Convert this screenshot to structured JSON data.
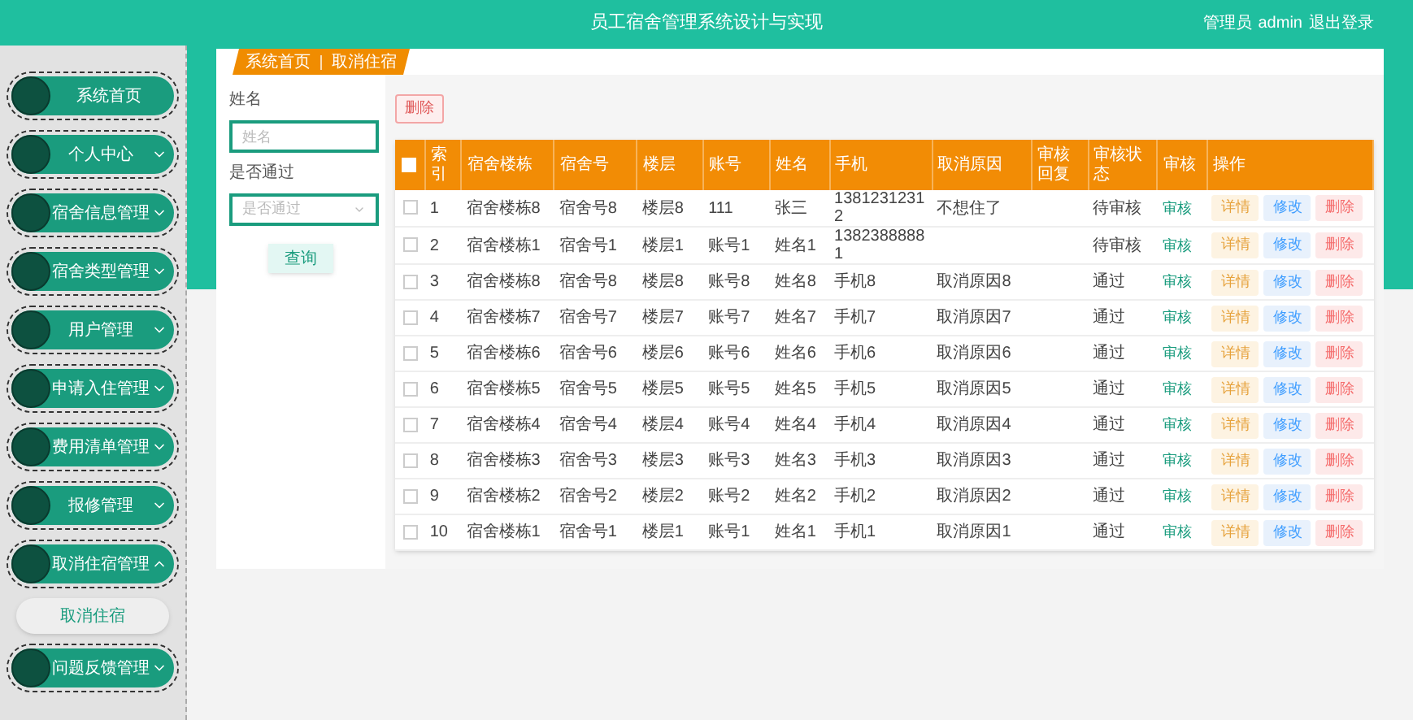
{
  "header": {
    "title": "员工宿舍管理系统设计与实现",
    "user_role": "管理员",
    "username": "admin",
    "logout": "退出登录"
  },
  "sidebar": {
    "items": [
      {
        "label": "系统首页"
      },
      {
        "label": "个人中心",
        "expanded": false
      },
      {
        "label": "宿舍信息管理",
        "expanded": false
      },
      {
        "label": "宿舍类型管理",
        "expanded": false
      },
      {
        "label": "用户管理",
        "expanded": false
      },
      {
        "label": "申请入住管理",
        "expanded": false
      },
      {
        "label": "费用清单管理",
        "expanded": false
      },
      {
        "label": "报修管理",
        "expanded": false
      },
      {
        "label": "取消住宿管理",
        "expanded": true,
        "children": [
          {
            "label": "取消住宿",
            "selected": true
          }
        ]
      },
      {
        "label": "问题反馈管理",
        "expanded": false
      }
    ]
  },
  "breadcrumb": [
    "系统首页",
    "取消住宿"
  ],
  "search": {
    "fields": [
      {
        "label": "姓名",
        "kind": "input",
        "placeholder": "姓名"
      },
      {
        "label": "是否通过",
        "kind": "select",
        "placeholder": "是否通过"
      }
    ],
    "button": "查询"
  },
  "table": {
    "delete_button": "删除",
    "select_all": {
      "checked": false
    },
    "columns": [
      "索引",
      "宿舍楼栋",
      "宿舍号",
      "楼层",
      "账号",
      "姓名",
      "手机",
      "取消原因",
      "审核回复",
      "审核状态",
      "审核",
      "操作"
    ],
    "rows": [
      {
        "checked": false,
        "cells": [
          "1",
          "宿舍楼栋8",
          "宿舍号8",
          "楼层8",
          "111",
          "张三",
          "13812312312",
          "不想住了",
          "",
          "待审核"
        ],
        "review": "审核",
        "actions": [
          {
            "label": "详情",
            "kind": "detail"
          },
          {
            "label": "修改",
            "kind": "edit"
          },
          {
            "label": "删除",
            "kind": "delete"
          }
        ]
      },
      {
        "checked": false,
        "cells": [
          "2",
          "宿舍楼栋1",
          "宿舍号1",
          "楼层1",
          "账号1",
          "姓名1",
          "13823888881",
          "",
          "",
          "待审核"
        ],
        "review": "审核",
        "actions": [
          {
            "label": "详情",
            "kind": "detail"
          },
          {
            "label": "修改",
            "kind": "edit"
          },
          {
            "label": "删除",
            "kind": "delete"
          }
        ]
      },
      {
        "checked": false,
        "cells": [
          "3",
          "宿舍楼栋8",
          "宿舍号8",
          "楼层8",
          "账号8",
          "姓名8",
          "手机8",
          "取消原因8",
          "",
          "通过"
        ],
        "review": "审核",
        "actions": [
          {
            "label": "详情",
            "kind": "detail"
          },
          {
            "label": "修改",
            "kind": "edit"
          },
          {
            "label": "删除",
            "kind": "delete"
          }
        ]
      },
      {
        "checked": false,
        "cells": [
          "4",
          "宿舍楼栋7",
          "宿舍号7",
          "楼层7",
          "账号7",
          "姓名7",
          "手机7",
          "取消原因7",
          "",
          "通过"
        ],
        "review": "审核",
        "actions": [
          {
            "label": "详情",
            "kind": "detail"
          },
          {
            "label": "修改",
            "kind": "edit"
          },
          {
            "label": "删除",
            "kind": "delete"
          }
        ]
      },
      {
        "checked": false,
        "cells": [
          "5",
          "宿舍楼栋6",
          "宿舍号6",
          "楼层6",
          "账号6",
          "姓名6",
          "手机6",
          "取消原因6",
          "",
          "通过"
        ],
        "review": "审核",
        "actions": [
          {
            "label": "详情",
            "kind": "detail"
          },
          {
            "label": "修改",
            "kind": "edit"
          },
          {
            "label": "删除",
            "kind": "delete"
          }
        ]
      },
      {
        "checked": false,
        "cells": [
          "6",
          "宿舍楼栋5",
          "宿舍号5",
          "楼层5",
          "账号5",
          "姓名5",
          "手机5",
          "取消原因5",
          "",
          "通过"
        ],
        "review": "审核",
        "actions": [
          {
            "label": "详情",
            "kind": "detail"
          },
          {
            "label": "修改",
            "kind": "edit"
          },
          {
            "label": "删除",
            "kind": "delete"
          }
        ]
      },
      {
        "checked": false,
        "cells": [
          "7",
          "宿舍楼栋4",
          "宿舍号4",
          "楼层4",
          "账号4",
          "姓名4",
          "手机4",
          "取消原因4",
          "",
          "通过"
        ],
        "review": "审核",
        "actions": [
          {
            "label": "详情",
            "kind": "detail"
          },
          {
            "label": "修改",
            "kind": "edit"
          },
          {
            "label": "删除",
            "kind": "delete"
          }
        ]
      },
      {
        "checked": false,
        "cells": [
          "8",
          "宿舍楼栋3",
          "宿舍号3",
          "楼层3",
          "账号3",
          "姓名3",
          "手机3",
          "取消原因3",
          "",
          "通过"
        ],
        "review": "审核",
        "actions": [
          {
            "label": "详情",
            "kind": "detail"
          },
          {
            "label": "修改",
            "kind": "edit"
          },
          {
            "label": "删除",
            "kind": "delete"
          }
        ]
      },
      {
        "checked": false,
        "cells": [
          "9",
          "宿舍楼栋2",
          "宿舍号2",
          "楼层2",
          "账号2",
          "姓名2",
          "手机2",
          "取消原因2",
          "",
          "通过"
        ],
        "review": "审核",
        "actions": [
          {
            "label": "详情",
            "kind": "detail"
          },
          {
            "label": "修改",
            "kind": "edit"
          },
          {
            "label": "删除",
            "kind": "delete"
          }
        ]
      },
      {
        "checked": false,
        "cells": [
          "10",
          "宿舍楼栋1",
          "宿舍号1",
          "楼层1",
          "账号1",
          "姓名1",
          "手机1",
          "取消原因1",
          "",
          "通过"
        ],
        "review": "审核",
        "actions": [
          {
            "label": "详情",
            "kind": "detail"
          },
          {
            "label": "修改",
            "kind": "edit"
          },
          {
            "label": "删除",
            "kind": "delete"
          }
        ]
      }
    ]
  }
}
